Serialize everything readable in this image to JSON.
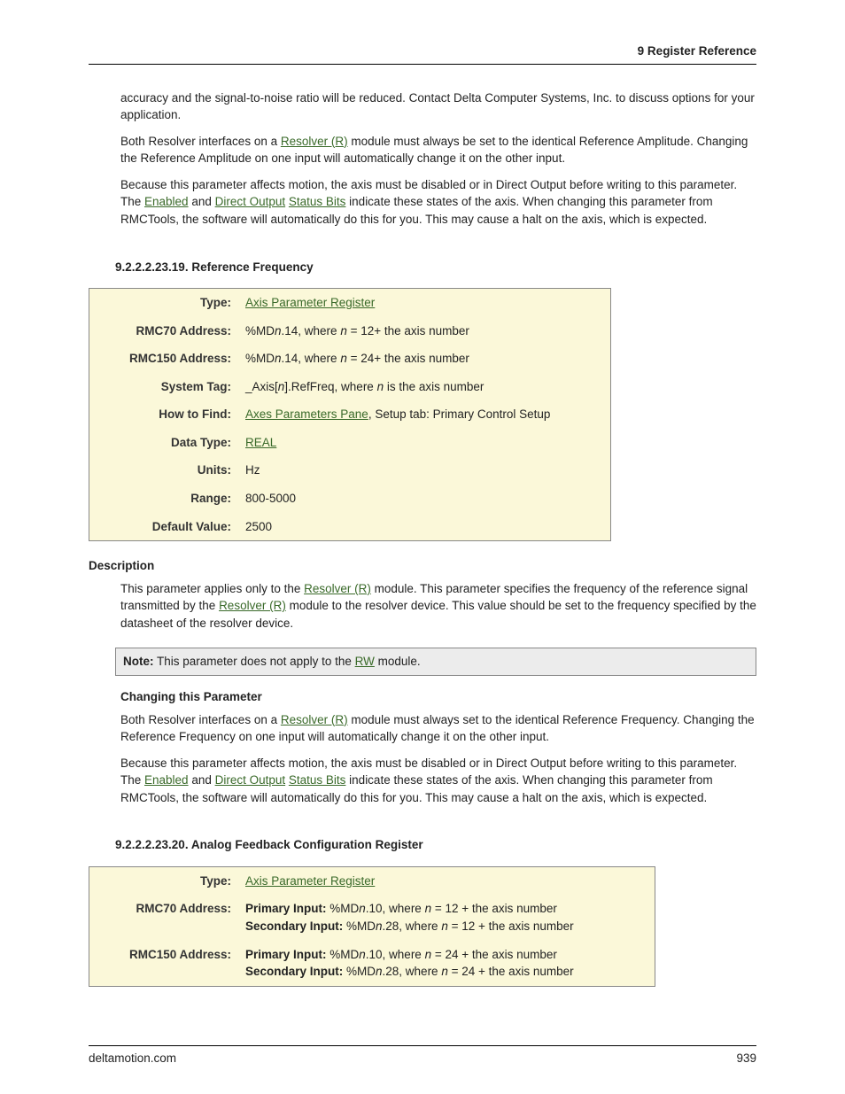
{
  "header": {
    "chapter": "9  Register Reference"
  },
  "intro": {
    "p1": "accuracy and the signal-to-noise ratio will be reduced. Contact Delta Computer Systems, Inc. to discuss options for your application.",
    "p2a": "Both Resolver interfaces on a ",
    "p2link": "Resolver (R)",
    "p2b": " module must always be set to the identical Reference Amplitude. Changing the Reference Amplitude on one input will automatically change it on the other input.",
    "p3a": "Because this parameter affects motion, the axis must be disabled or in Direct Output before writing to this parameter. The ",
    "p3l1": "Enabled",
    "p3b": " and ",
    "p3l2": "Direct Output",
    "p3c": " ",
    "p3l3": "Status Bits",
    "p3d": " indicate these states of the axis. When changing this parameter from RMCTools, the software will automatically do this for you. This may cause a halt on the axis, which is expected."
  },
  "sec19": {
    "title": "9.2.2.2.23.19. Reference Frequency",
    "rows": {
      "type_lbl": "Type:",
      "type_link": "Axis Parameter Register",
      "r70_lbl": "RMC70 Address:",
      "r70_a": "%MD",
      "r70_n": "n",
      "r70_b": ".14, where ",
      "r70_n2": "n",
      "r70_c": " = 12+ the axis number",
      "r150_lbl": "RMC150 Address:",
      "r150_a": "%MD",
      "r150_n": "n",
      "r150_b": ".14, where ",
      "r150_n2": "n",
      "r150_c": " = 24+ the axis number",
      "tag_lbl": "System Tag:",
      "tag_a": "_Axis[",
      "tag_n": "n",
      "tag_b": "].RefFreq, where ",
      "tag_n2": "n",
      "tag_c": " is the axis number",
      "find_lbl": "How to Find:",
      "find_link": "Axes Parameters Pane",
      "find_rest": ", Setup tab: Primary Control Setup",
      "dtype_lbl": "Data Type:",
      "dtype_link": "REAL",
      "units_lbl": "Units:",
      "units_val": "Hz",
      "range_lbl": "Range:",
      "range_val": "800-5000",
      "def_lbl": "Default Value:",
      "def_val": "2500"
    },
    "desc_head": "Description",
    "desc_a": "This parameter applies only to the ",
    "desc_l1": "Resolver (R)",
    "desc_b": " module. This parameter specifies the frequency of the reference signal transmitted by the ",
    "desc_l2": "Resolver (R)",
    "desc_c": " module to the resolver device. This value should be set to the frequency specified by the datasheet of the resolver device.",
    "note_b": "Note:",
    "note_a": " This parameter does not apply to the ",
    "note_l": "RW",
    "note_c": " module.",
    "chg_head": "Changing this Parameter",
    "chg1a": "Both Resolver interfaces on a ",
    "chg1l": "Resolver (R)",
    "chg1b": " module must always set to the identical Reference Frequency. Changing the Reference Frequency on one input will automatically change it on the other input.",
    "chg2a": "Because this parameter affects motion, the axis must be disabled or in Direct Output before writing to this parameter. The ",
    "chg2l1": "Enabled",
    "chg2b": " and ",
    "chg2l2": "Direct Output",
    "chg2c": " ",
    "chg2l3": "Status Bits",
    "chg2d": " indicate these states of the axis. When changing this parameter from RMCTools, the software will automatically do this for you. This may cause a halt on the axis, which is expected."
  },
  "sec20": {
    "title": "9.2.2.2.23.20. Analog Feedback Configuration Register",
    "rows": {
      "type_lbl": "Type:",
      "type_link": "Axis Parameter Register",
      "r70_lbl": "RMC70 Address:",
      "r70_p_b": "Primary Input:",
      "r70_p_a": " %MD",
      "r70_p_n": "n",
      "r70_p_c": ".10, where ",
      "r70_p_n2": "n",
      "r70_p_d": " = 12 + the axis number",
      "r70_s_b": "Secondary Input:",
      "r70_s_a": " %MD",
      "r70_s_n": "n",
      "r70_s_c": ".28, where ",
      "r70_s_n2": "n",
      "r70_s_d": " = 12 + the axis number",
      "r150_lbl": "RMC150 Address:",
      "r150_p_b": "Primary Input:",
      "r150_p_a": " %MD",
      "r150_p_n": "n",
      "r150_p_c": ".10, where ",
      "r150_p_n2": "n",
      "r150_p_d": " = 24 + the axis number",
      "r150_s_b": "Secondary Input:",
      "r150_s_a": " %MD",
      "r150_s_n": "n",
      "r150_s_c": ".28, where ",
      "r150_s_n2": "n",
      "r150_s_d": " = 24 + the axis number"
    }
  },
  "footer": {
    "site": "deltamotion.com",
    "page": "939"
  }
}
